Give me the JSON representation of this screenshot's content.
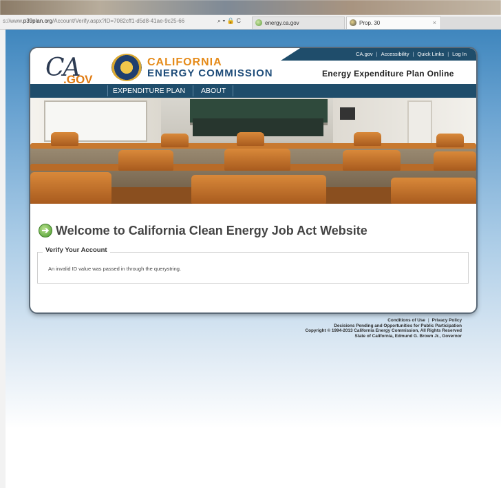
{
  "browser": {
    "url_prefix": "s://www.",
    "url_domain": "p39plan.org",
    "url_path": "/Account/Verify.aspx?ID=7082cff1-d5d8-41ae-9c25-66",
    "url_icons": "⌕ ▾ 🔒 C",
    "tabs": [
      {
        "label": "energy.ca.gov"
      },
      {
        "label": "Prop. 30",
        "close": "×"
      }
    ]
  },
  "header": {
    "cagov_logo": "CA",
    "cagov_sub": ".GOV",
    "org_line1": "CALIFORNIA",
    "org_line2": "ENERGY COMMISSION",
    "util_links": [
      "CA.gov",
      "Accessibility",
      "Quick Links",
      "Log In"
    ],
    "site_title": "Energy Expenditure Plan Online"
  },
  "nav": {
    "items": [
      "EXPENDITURE PLAN",
      "ABOUT"
    ]
  },
  "content": {
    "welcome_icon": "➔",
    "welcome_title": "Welcome to California Clean Energy Job Act Website",
    "section_legend": "Verify Your Account",
    "message": "An invalid ID value was passed in through the querystring."
  },
  "footer": {
    "link1": "Conditions of Use",
    "sep": "|",
    "link2": "Privacy Policy",
    "line2": "Decisions Pending and Opportunities for Public Participation",
    "line3": "Copyright © 1994-2013 California Energy Commission, All Rights Reserved",
    "line4": "State of California, Edmund G. Brown Jr., Governor"
  },
  "colors": {
    "nav_bg": "#1f4d6b",
    "orange": "#e58b1a",
    "navy": "#1f4d7a",
    "page_blue": "#3f86bd"
  }
}
